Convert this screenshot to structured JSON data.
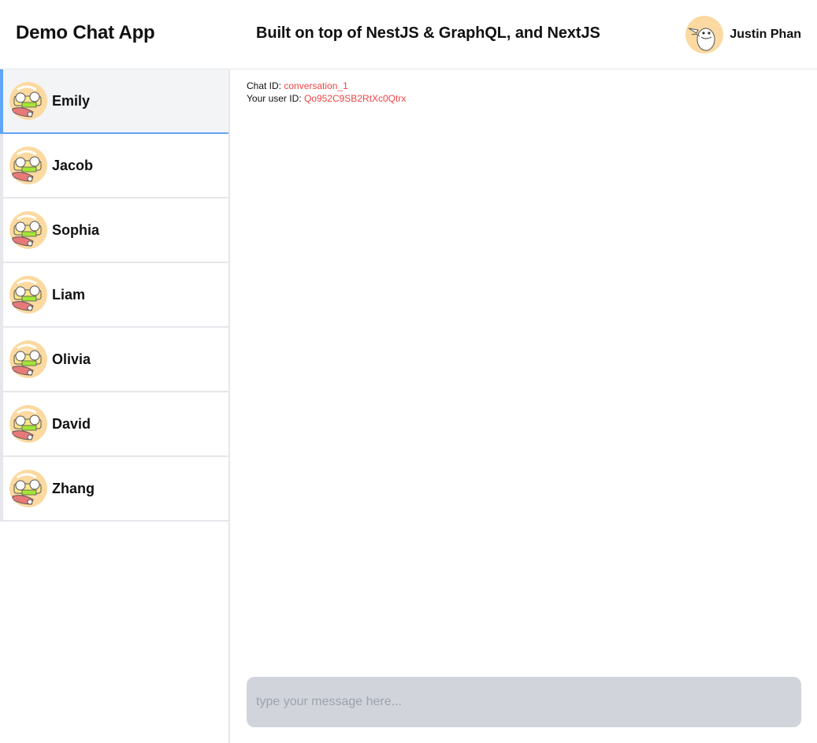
{
  "header": {
    "app_title": "Demo Chat App",
    "tagline": "Built on top of NestJS & GraphQL, and NextJS",
    "user_name": "Justin Phan"
  },
  "contacts": [
    {
      "name": "Emily",
      "active": true
    },
    {
      "name": "Jacob",
      "active": false
    },
    {
      "name": "Sophia",
      "active": false
    },
    {
      "name": "Liam",
      "active": false
    },
    {
      "name": "Olivia",
      "active": false
    },
    {
      "name": "David",
      "active": false
    },
    {
      "name": "Zhang",
      "active": false
    }
  ],
  "chat": {
    "chat_id_label": "Chat ID:",
    "chat_id_value": "conversation_1",
    "user_id_label": "Your user ID:",
    "user_id_value": "Qo952C9SB2RtXc0Qtrx"
  },
  "composer": {
    "placeholder": "type your message here...",
    "value": ""
  },
  "colors": {
    "accent": "#60a5fa",
    "id_text": "#ef4444",
    "composer_bg": "#d1d5db",
    "active_bg": "#f3f4f6"
  },
  "icons": {
    "user_avatar": "duck-avatar-icon",
    "contact_avatar": "cartoon-avatar-icon"
  }
}
